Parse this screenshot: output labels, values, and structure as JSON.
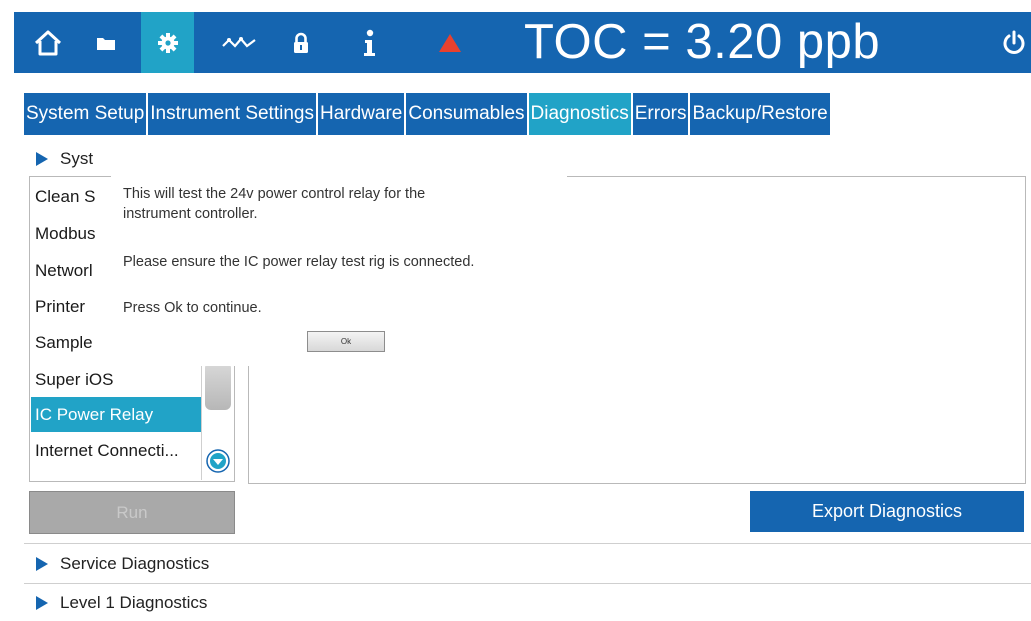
{
  "header": {
    "toc_reading": "TOC = 3.20 ppb",
    "colors": {
      "bar": "#1565b0",
      "active": "#21a3c7",
      "alert": "#e8412e"
    },
    "icons": [
      "home-icon",
      "folder-icon",
      "gear-icon",
      "trend-icon",
      "lock-icon",
      "info-icon",
      "warning-icon",
      "power-icon"
    ]
  },
  "tabs": [
    {
      "label": "System Setup"
    },
    {
      "label": "Instrument Settings"
    },
    {
      "label": "Hardware"
    },
    {
      "label": "Consumables"
    },
    {
      "label": "Diagnostics",
      "active": true
    },
    {
      "label": "Errors"
    },
    {
      "label": "Backup/Restore"
    }
  ],
  "sections": {
    "system": "Syst",
    "service": "Service Diagnostics",
    "level1": "Level 1 Diagnostics"
  },
  "list": {
    "items": [
      "Clean S",
      "Modbus",
      "Networl",
      "Printer",
      "Sample",
      "Super iOS",
      "IC Power Relay",
      "Internet Connecti..."
    ],
    "selected": "IC Power Relay"
  },
  "dialog": {
    "line1": "This will test the 24v power control relay for the",
    "line2": "instrument controller.",
    "line3": "Please ensure the IC power relay test rig is connected.",
    "line4": "Press Ok to continue.",
    "ok_label": "Ok"
  },
  "buttons": {
    "run_label": "Run",
    "export_label": "Export Diagnostics"
  }
}
